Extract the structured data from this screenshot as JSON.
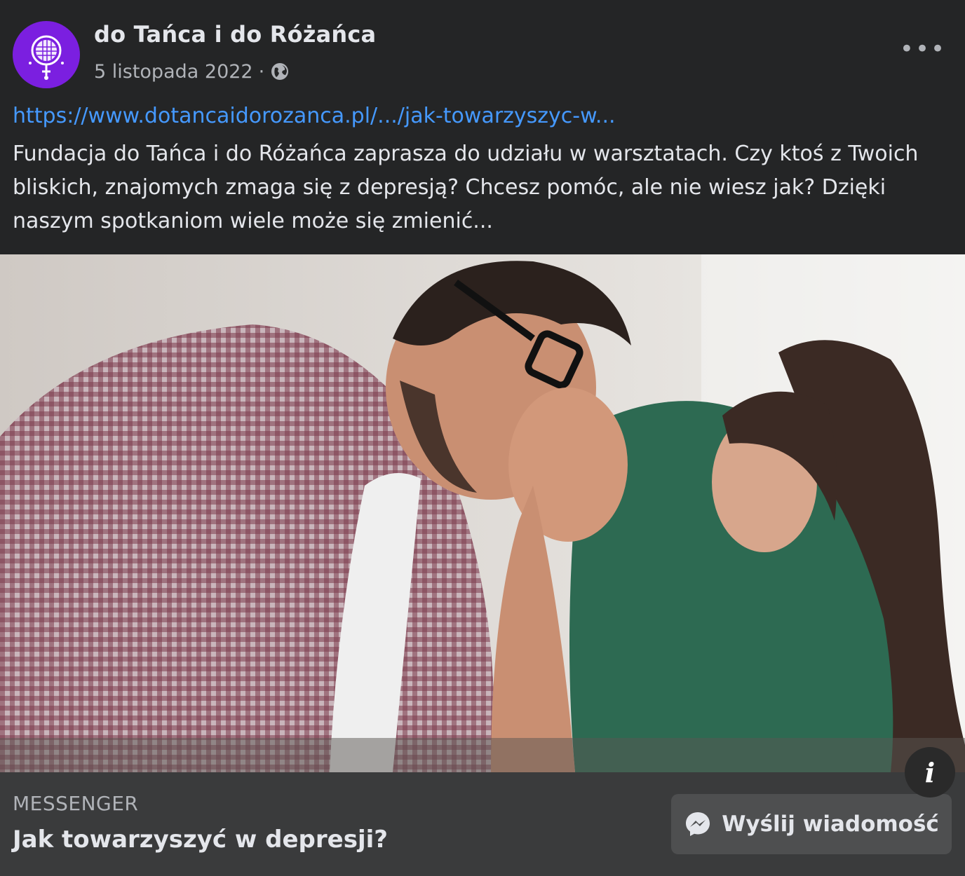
{
  "header": {
    "page_name": "do Tańca i do Różańca",
    "date": "5 listopada 2022",
    "separator": "·",
    "privacy_icon": "globe-icon",
    "more_label": "•••",
    "avatar_icon": "disco-ball-rosary-logo"
  },
  "body": {
    "link": "https://www.dotancaidorozanca.pl/.../jak-towarzyszyc-w...",
    "message": "Fundacja do Tańca i do Różańca zaprasza do udziału w warsztatach. Czy ktoś z Twoich bliskich, znajomych zmaga się z depresją? Chcesz pomóc, ale nie wiesz jak? Dzięki naszym spotkaniom wiele może się zmienić..."
  },
  "image": {
    "info_label": "i"
  },
  "footer": {
    "source": "MESSENGER",
    "headline": "Jak towarzyszyć w depresji?",
    "button_label": "Wyślij wiadomość",
    "button_icon": "messenger-icon"
  },
  "colors": {
    "background": "#242526",
    "footer": "#3a3b3c",
    "link": "#4599ff",
    "avatar": "#7b1fe0"
  }
}
